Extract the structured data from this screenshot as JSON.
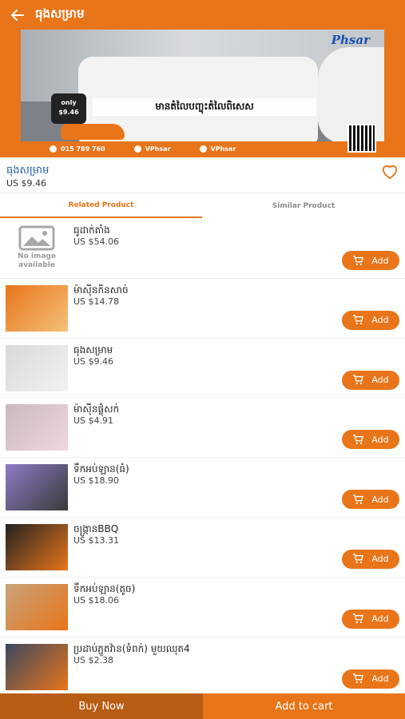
{
  "header": {
    "title": "ធុងសម្រាម"
  },
  "hero": {
    "brand": "Phsar",
    "banner_text": "មានតំលៃបញ្ចុះតំលៃពិសេស",
    "price_badge_top": "only",
    "price_badge_value": "$9.46",
    "contacts": [
      "015 789 760",
      "VPhsar",
      "VPhsar"
    ]
  },
  "product": {
    "name": "ធុងសម្រាម",
    "price": "US $9.46"
  },
  "tabs": [
    {
      "label": "Related Product",
      "active": true
    },
    {
      "label": "Similar Product",
      "active": false
    }
  ],
  "no_image_text": "No image available",
  "add_label": "Add",
  "items": [
    {
      "name": "ធូដាក់តាំង",
      "price": "US $54.06",
      "thumb": "none",
      "colors": [
        "#e9e9e9",
        "#cfcfcf"
      ]
    },
    {
      "name": "ម៉ាស៊ីនកិនសាច់",
      "price": "US $14.78",
      "thumb": "img",
      "colors": [
        "#e8751a",
        "#f4c07a"
      ]
    },
    {
      "name": "ធុងសម្រាម",
      "price": "US $9.46",
      "thumb": "img",
      "colors": [
        "#d7d9dc",
        "#f2f2f0"
      ]
    },
    {
      "name": "ម៉ាស៊ីនផ្លុំសក់",
      "price": "US $4.91",
      "thumb": "img",
      "colors": [
        "#c9b9c2",
        "#f1d7dd"
      ]
    },
    {
      "name": "ទឹកអប់ឡាន(ធំ)",
      "price": "US $18.90",
      "thumb": "img",
      "colors": [
        "#8f7bc8",
        "#3a3a3a"
      ]
    },
    {
      "name": "ចង្រ្កានBBQ",
      "price": "US $13.31",
      "thumb": "img",
      "colors": [
        "#222222",
        "#e8751a"
      ]
    },
    {
      "name": "ទឹកអប់ឡាន(តូច)",
      "price": "US $18.06",
      "thumb": "img",
      "colors": [
        "#c8a37a",
        "#e8751a"
      ]
    },
    {
      "name": "ប្រដាប់ភ្ជួតវ៉ាន(ទំពក់) មួយឈុត4",
      "price": "US $2.38",
      "thumb": "img",
      "colors": [
        "#3c4860",
        "#e8751a"
      ]
    }
  ],
  "footer": {
    "buy_now": "Buy Now",
    "add_to_cart": "Add to cart"
  },
  "colors": {
    "accent": "#e8751a",
    "accent_dark": "#b85d14",
    "link": "#1f5fa8"
  }
}
